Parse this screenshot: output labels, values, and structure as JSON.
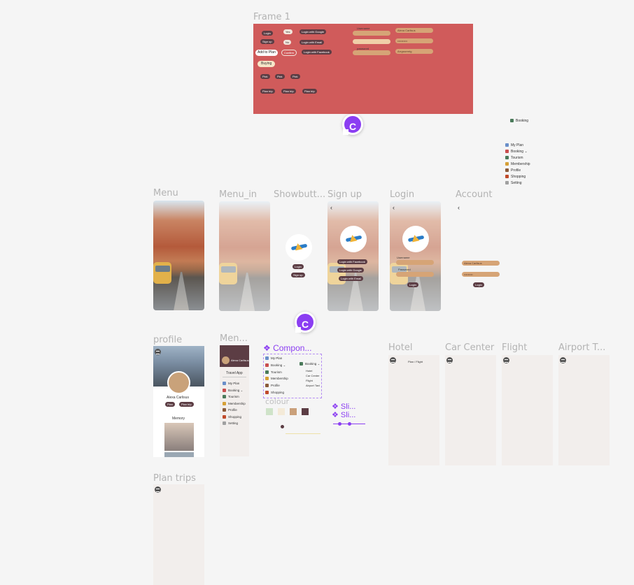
{
  "frames": {
    "frame1": "Frame 1",
    "menu": "Menu",
    "menu_in": "Menu_in",
    "showbutt": "Showbutt...",
    "signup": "Sign up",
    "login": "Login",
    "account": "Account",
    "profile": "profile",
    "men": "Men...",
    "compon": "Compon...",
    "colour": "colour",
    "hotel": "Hotel",
    "car_center": "Car Center",
    "flight": "Flight",
    "airport": "Airport T...",
    "plan_trips": "Plan trips"
  },
  "frame1": {
    "login": "Login",
    "signup": "Sign up",
    "yes": "Yes",
    "no": "No",
    "add_to_plan": "Add to Plan",
    "confirm": "Confirm",
    "buying": "Buying",
    "login_google": "Login with Google",
    "login_email": "Login with Email",
    "login_facebook": "Login with Facebook",
    "pick1": "Pick",
    "pick2": "Pick",
    "pick3": "Pick",
    "plan_trip1": "Plan trip",
    "plan_trip2": "Plan trip",
    "plan_trip3": "Plan trip",
    "username_label": "Username",
    "password_label": "password",
    "field_name": "Alexa Carlisus",
    "field_dots": "••••••••••",
    "field_pwd": "Arrgssemtg",
    "field_dots2": "••••••••"
  },
  "cursors": {
    "c1": "C",
    "c2": "C"
  },
  "floating_menu": {
    "booking_top": "Booking",
    "items": [
      "My Plan",
      "Booking ⌄",
      "Tourism",
      "Membership",
      "Profile",
      "Shopping",
      "Setting"
    ],
    "colors": [
      "#6a8fc9",
      "#c94e4e",
      "#4a7a5a",
      "#d6a036",
      "#8a5a3a",
      "#c04a2a",
      "#a0a0a0"
    ]
  },
  "showbutt": {
    "login": "Login",
    "signup": "Sign up"
  },
  "signup": {
    "facebook": "Login with Facebook",
    "google": "Login with Google",
    "email": "Login with Email"
  },
  "login_frame": {
    "username": "Username",
    "password": "Password",
    "login": "Login"
  },
  "account": {
    "name": "Alexa Carlisus",
    "dots": "•••••••••",
    "login": "Login"
  },
  "profile": {
    "name": "Alexa Carlisus",
    "btn1": "Plan",
    "btn2": "Plan trip",
    "memory": "Memory"
  },
  "menu_panel": {
    "user": "Alexa Carlisus",
    "app": "Travel App",
    "items": [
      "My Plan",
      "Booking ⌄",
      "Tourism",
      "Membership",
      "Profile",
      "Shopping",
      "Setting"
    ]
  },
  "component": {
    "items": [
      "My Plan",
      "Booking ⌄",
      "Tourism",
      "Membership",
      "Profile",
      "Shopping",
      "Setting"
    ],
    "booking": "Booking ⌄",
    "sub": [
      "Hotel",
      "Car Center",
      "Flight",
      "Airport Taxi"
    ]
  },
  "colour_swatches": [
    "#cfe3c9",
    "#f4ead8",
    "#caa07a",
    "#5c3d44"
  ],
  "sliders": {
    "s1": "Sli...",
    "s2": "Sli..."
  },
  "hotel": {
    "label": "Plan / Flight"
  }
}
